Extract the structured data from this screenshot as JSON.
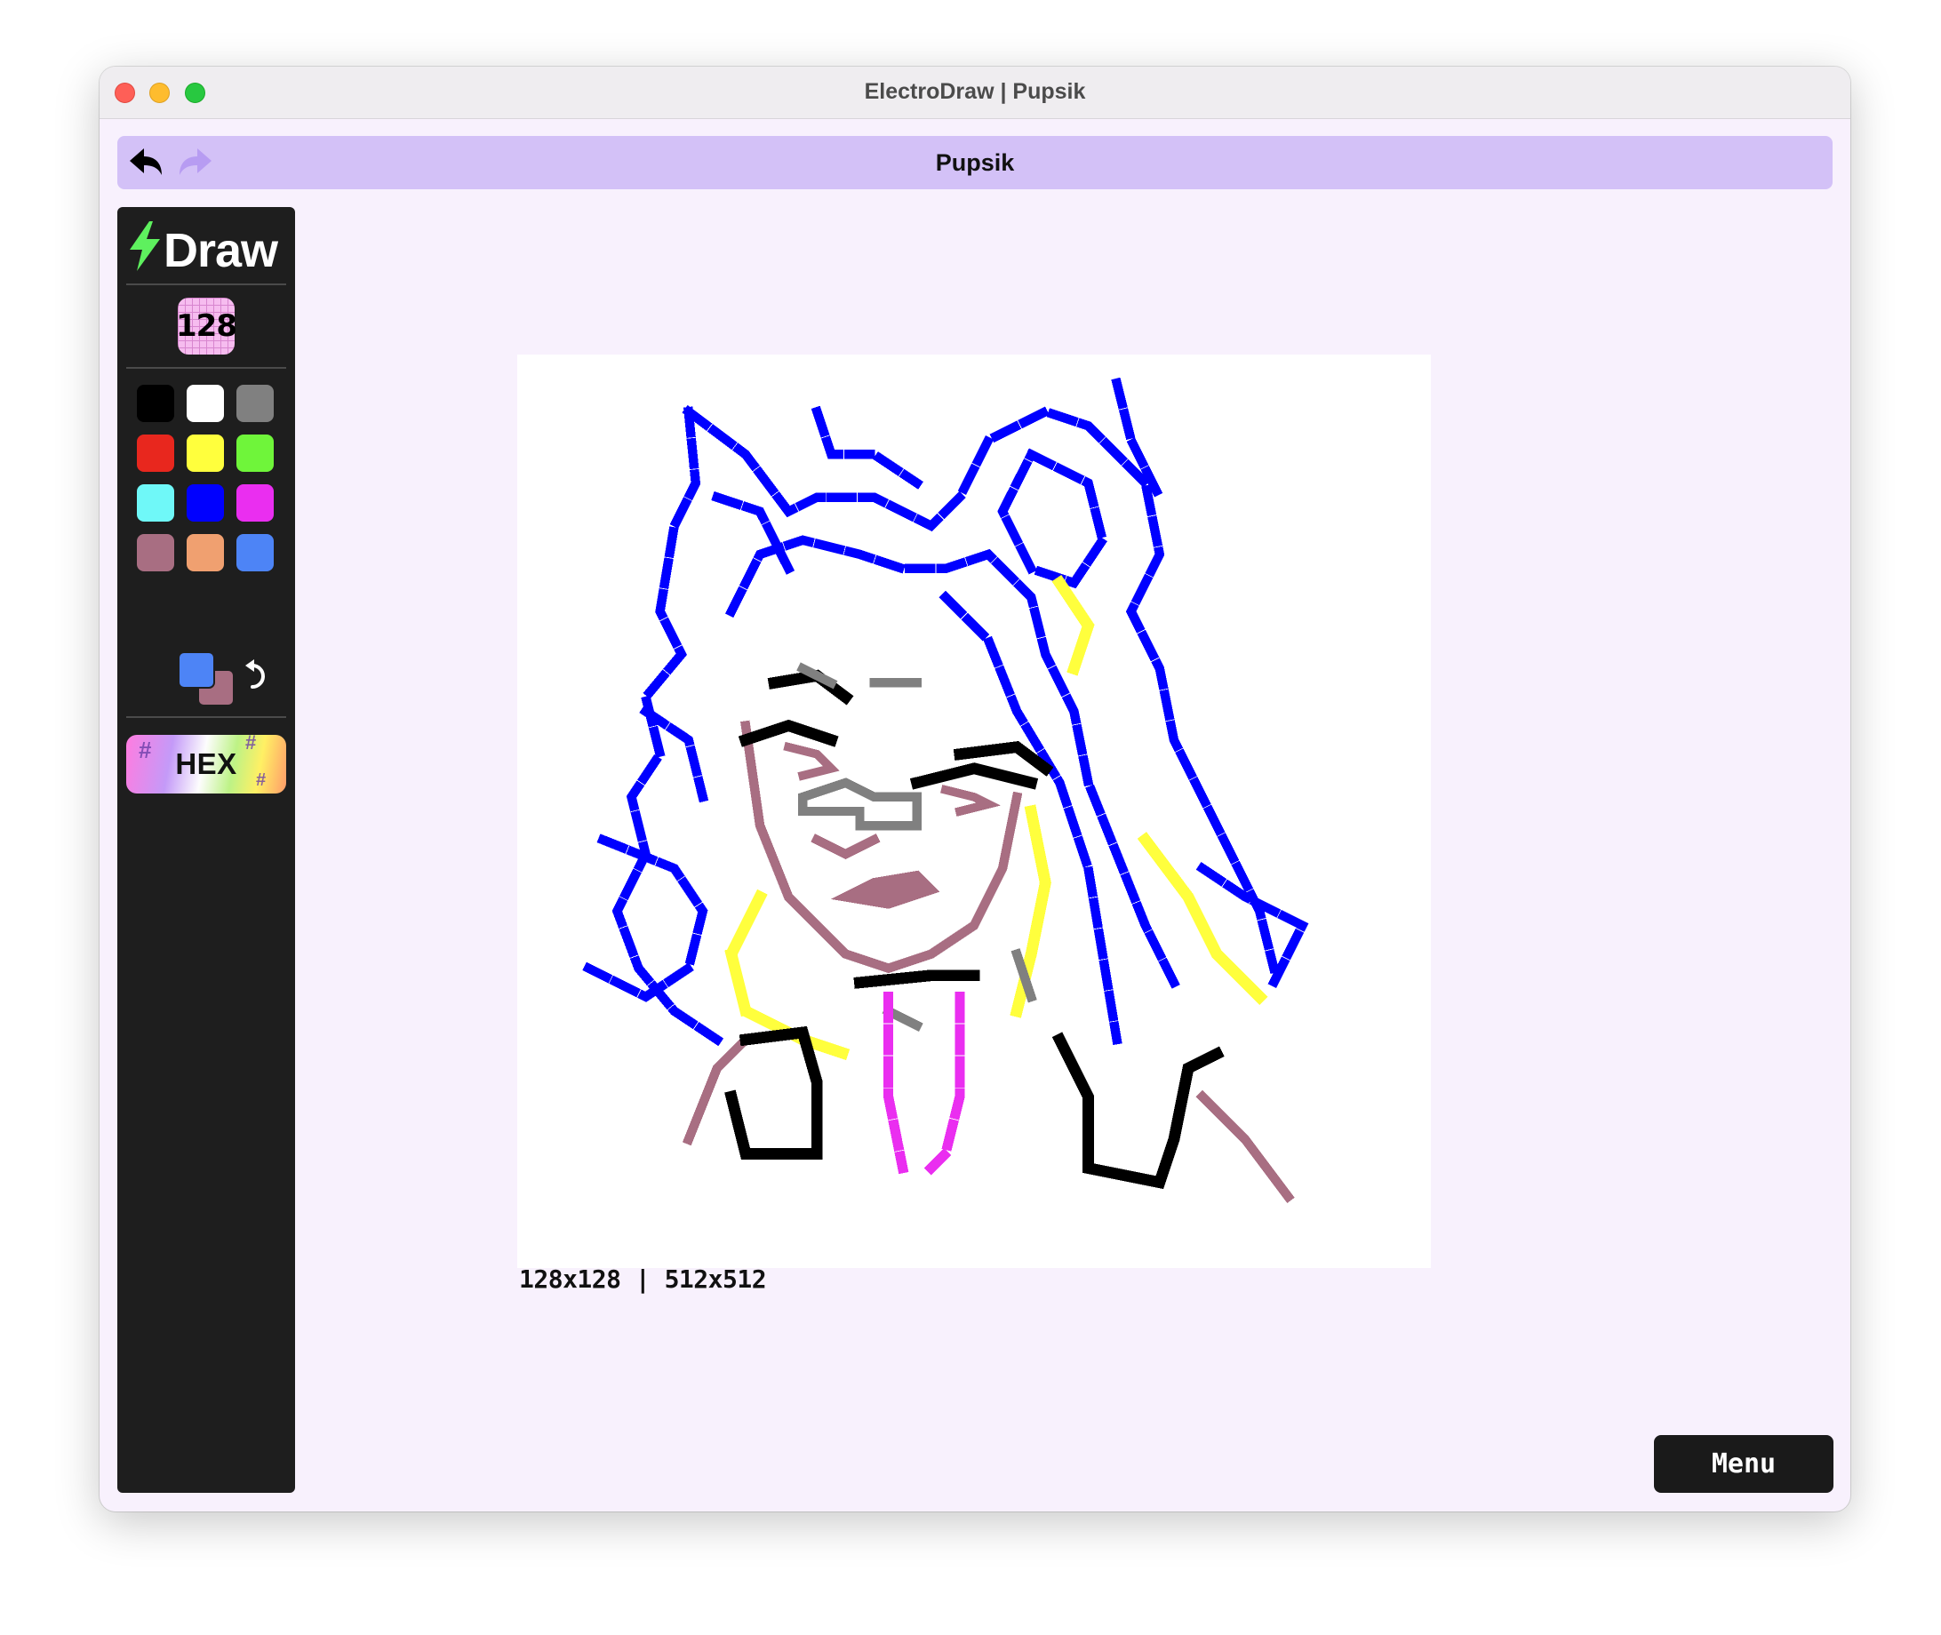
{
  "window": {
    "title": "ElectroDraw | Pupsik"
  },
  "topbar": {
    "document_title": "Pupsik",
    "undo_icon": "undo-arrow-icon",
    "redo_icon": "redo-arrow-icon"
  },
  "sidebar": {
    "logo_text": "Draw",
    "logo_icon": "lightning-bolt-icon",
    "grid_size_label": "128",
    "palette": [
      "#000000",
      "#ffffff",
      "#808080",
      "#e8271e",
      "#ffff3d",
      "#6ff53a",
      "#6ff8f8",
      "#0000ff",
      "#ea2ef0",
      "#a86e82",
      "#f0a070",
      "#4d84f6"
    ],
    "primary_color": "#4d84f6",
    "secondary_color": "#a86e82",
    "swap_icon": "swap-colors-icon",
    "hex_label": "HEX"
  },
  "canvas": {
    "size_info": "128x128 | 512x512"
  },
  "footer": {
    "menu_label": "Menu"
  }
}
